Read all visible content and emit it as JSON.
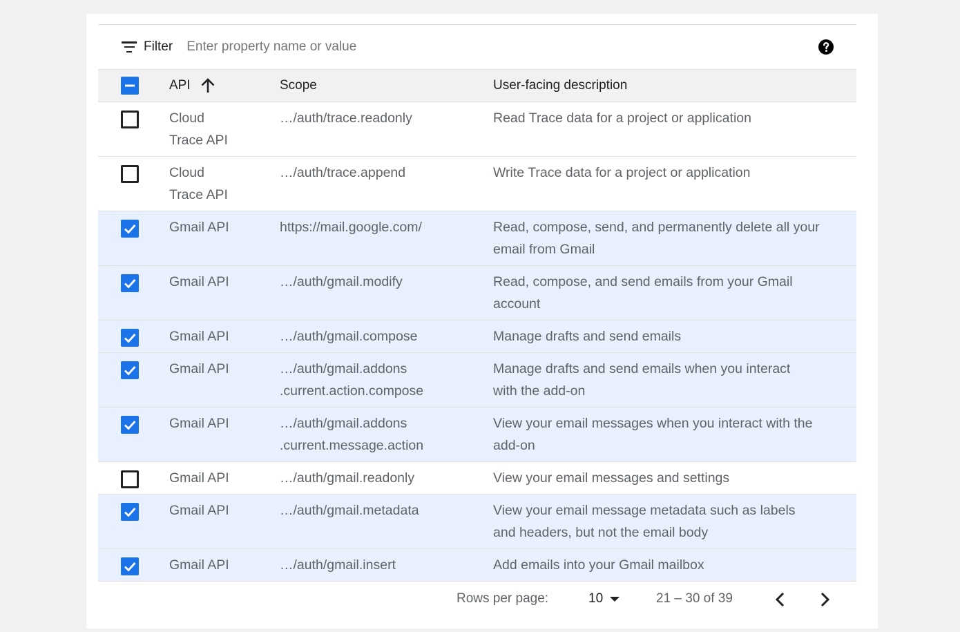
{
  "filter": {
    "label": "Filter",
    "placeholder": "Enter property name or value",
    "icon": "filter-list-icon",
    "help_icon": "help-icon"
  },
  "table": {
    "columns": {
      "api": "API",
      "scope": "Scope",
      "description": "User-facing description"
    },
    "sort": {
      "column": "api",
      "direction": "ascending",
      "icon": "arrow-upward-icon"
    },
    "header_checkbox_state": "indeterminate",
    "rows": [
      {
        "checked": false,
        "api": "Cloud\nTrace API",
        "scope": "…/auth/trace.readonly",
        "description": "Read Trace data for a project or application"
      },
      {
        "checked": false,
        "api": "Cloud\nTrace API",
        "scope": "…/auth/trace.append",
        "description": "Write Trace data for a project or application"
      },
      {
        "checked": true,
        "api": "Gmail API",
        "scope": "https://mail.google.com/",
        "description": "Read, compose, send, and permanently delete all your\nemail from Gmail"
      },
      {
        "checked": true,
        "api": "Gmail API",
        "scope": "…/auth/gmail.modify",
        "description": "Read, compose, and send emails from your Gmail\naccount"
      },
      {
        "checked": true,
        "api": "Gmail API",
        "scope": "…/auth/gmail.compose",
        "description": "Manage drafts and send emails"
      },
      {
        "checked": true,
        "api": "Gmail API",
        "scope": "…/auth/gmail.addons\n.current.action.compose",
        "description": "Manage drafts and send emails when you interact\nwith the add-on"
      },
      {
        "checked": true,
        "api": "Gmail API",
        "scope": "…/auth/gmail.addons\n.current.message.action",
        "description": "View your email messages when you interact with the\nadd-on"
      },
      {
        "checked": false,
        "api": "Gmail API",
        "scope": "…/auth/gmail.readonly",
        "description": "View your email messages and settings"
      },
      {
        "checked": true,
        "api": "Gmail API",
        "scope": "…/auth/gmail.metadata",
        "description": "View your email message metadata such as labels\nand headers, but not the email body"
      },
      {
        "checked": true,
        "api": "Gmail API",
        "scope": "…/auth/gmail.insert",
        "description": "Add emails into your Gmail mailbox"
      }
    ]
  },
  "pagination": {
    "rows_per_page_label": "Rows per page:",
    "rows_per_page_value": "10",
    "range_label": "21 – 30 of 39",
    "prev_icon": "chevron-left-icon",
    "next_icon": "chevron-right-icon"
  },
  "colors": {
    "accent": "#1a73e8",
    "selected_row_bg": "#e8f0fe",
    "header_bg": "#f1f1f1",
    "page_bg": "#f1f1f1",
    "divider": "#e0e0e0"
  }
}
